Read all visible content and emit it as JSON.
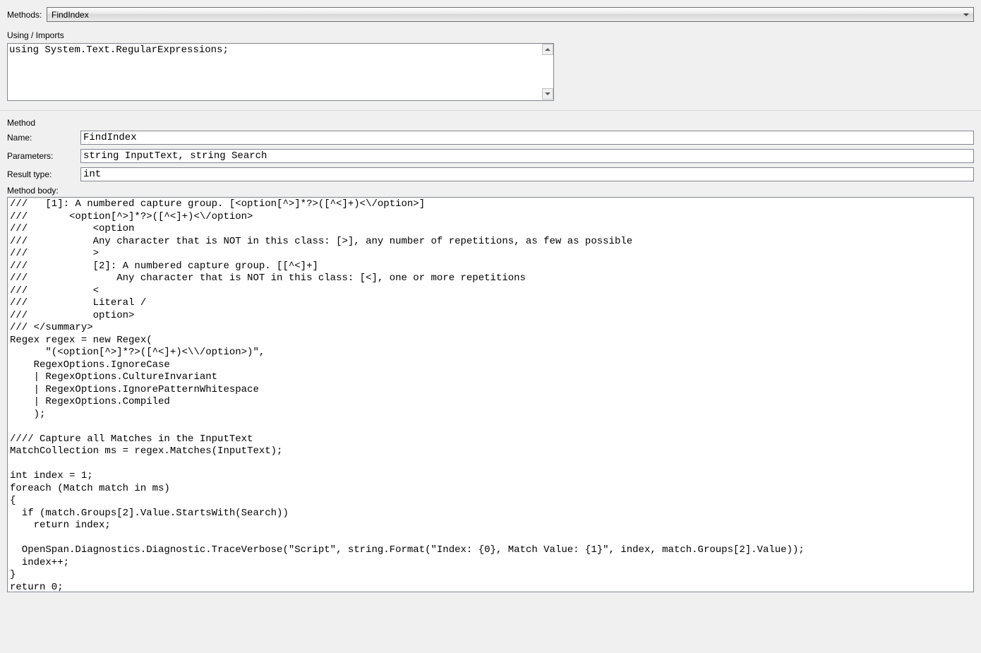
{
  "top": {
    "methods_label": "Methods:",
    "methods_value": "FindIndex"
  },
  "imports": {
    "label": "Using / Imports",
    "value": "using System.Text.RegularExpressions;"
  },
  "method": {
    "section_label": "Method",
    "name_label": "Name:",
    "name_value": "FindIndex",
    "params_label": "Parameters:",
    "params_value": "string InputText, string Search",
    "result_label": "Result type:",
    "result_value": "int",
    "body_label": "Method body:",
    "body_value": "///   [1]: A numbered capture group. [<option[^>]*?>([^<]+)<\\/option>]\n///       <option[^>]*?>([^<]+)<\\/option>\n///           <option\n///           Any character that is NOT in this class: [>], any number of repetitions, as few as possible\n///           >\n///           [2]: A numbered capture group. [[^<]+]\n///               Any character that is NOT in this class: [<], one or more repetitions\n///           <\n///           Literal /\n///           option>\n/// </summary>\nRegex regex = new Regex(\n      \"(<option[^>]*?>([^<]+)<\\\\/option>)\",\n    RegexOptions.IgnoreCase\n    | RegexOptions.CultureInvariant\n    | RegexOptions.IgnorePatternWhitespace\n    | RegexOptions.Compiled\n    );\n\n//// Capture all Matches in the InputText\nMatchCollection ms = regex.Matches(InputText);\n\nint index = 1;\nforeach (Match match in ms)\n{\n  if (match.Groups[2].Value.StartsWith(Search))\n    return index;\n\n  OpenSpan.Diagnostics.Diagnostic.TraceVerbose(\"Script\", string.Format(\"Index: {0}, Match Value: {1}\", index, match.Groups[2].Value));\n  index++;\n}\nreturn 0;"
  }
}
